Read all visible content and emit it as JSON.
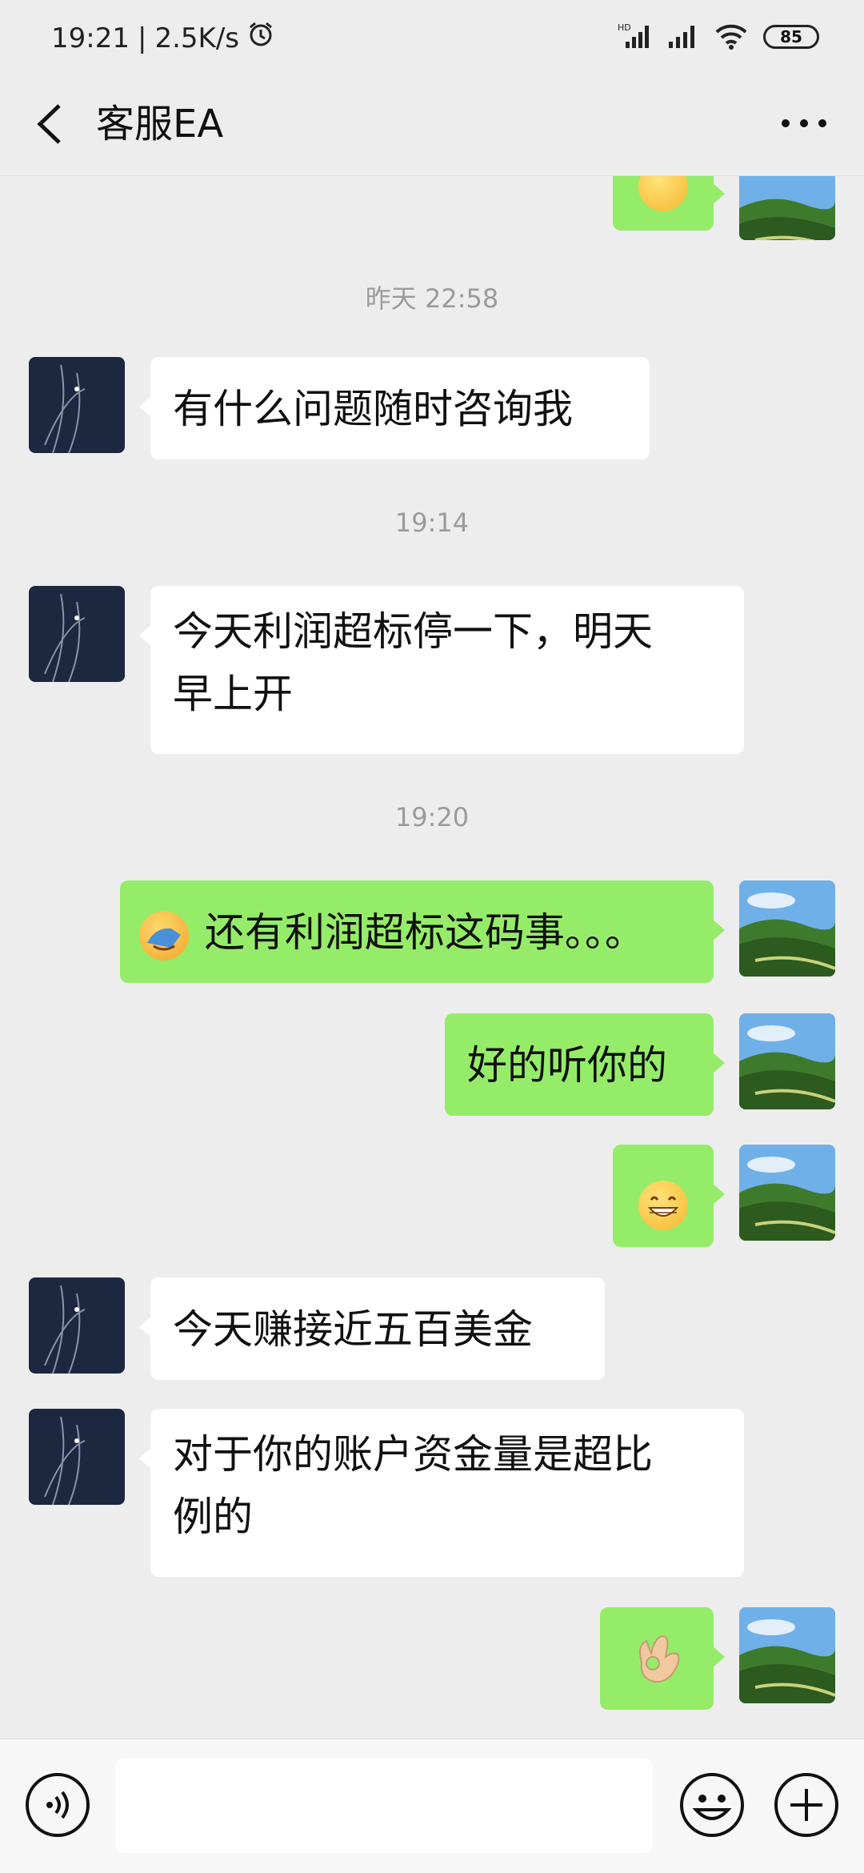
{
  "status_bar": {
    "time": "19:21",
    "separator": "|",
    "net_speed": "2.5K/s",
    "battery": "85",
    "icons": [
      "alarm-icon",
      "hd-signal-icon",
      "signal-icon",
      "wifi-icon",
      "battery-icon"
    ]
  },
  "header": {
    "title": "客服EA",
    "back_icon": "chevron-left-icon",
    "more_icon": "more-dots-icon"
  },
  "messages": {
    "ts1": "昨天 22:58",
    "m1": "有什么问题随时咨询我",
    "ts2": "19:14",
    "m2_line1": "今天利润超标停一下，明天",
    "m2_line2": "早上开",
    "ts3": "19:20",
    "m3": "还有利润超标这码事。。。",
    "m4": "好的听你的",
    "m6": "今天赚接近五百美金",
    "m7_line1": "对于你的账户资金量是超比",
    "m7_line2": "例的",
    "emoji_names": [
      "facepalm-emoji",
      "grin-emoji",
      "ok-hand-emoji"
    ]
  },
  "input_bar": {
    "value": "",
    "icons": [
      "voice-icon",
      "emoji-icon",
      "plus-icon"
    ]
  },
  "colors": {
    "background": "#ededed",
    "outgoing_bubble": "#95ec69",
    "incoming_bubble": "#ffffff",
    "timestamp": "#9b9b9b"
  }
}
